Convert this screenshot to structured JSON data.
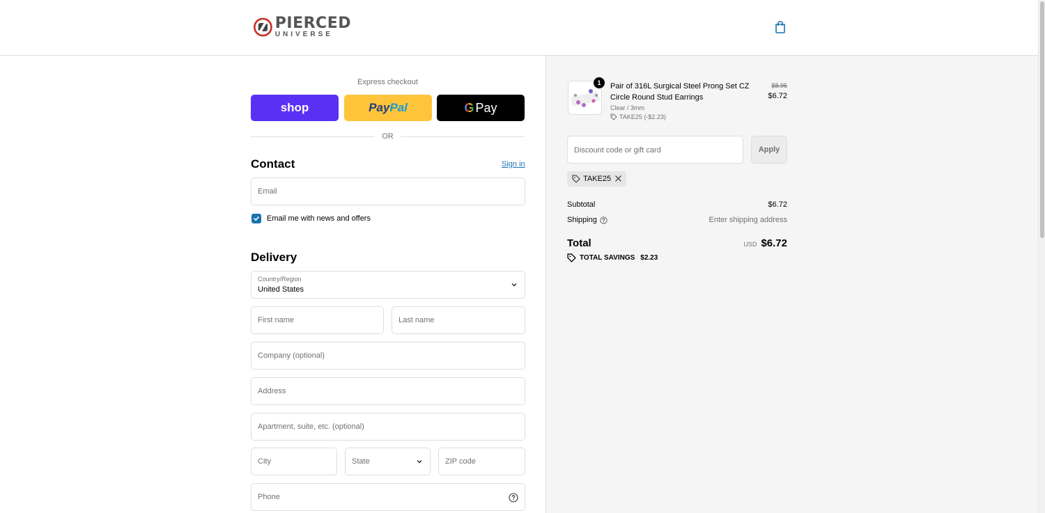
{
  "brand": {
    "logo_line1": "PIERCED",
    "logo_line2": "UNIVERSE"
  },
  "express": {
    "title": "Express checkout",
    "shop_label": "shop",
    "paypal_label_1": "Pay",
    "paypal_label_2": "Pal",
    "gpay_g": "G",
    "gpay_label": "Pay",
    "or_label": "OR"
  },
  "contact": {
    "heading": "Contact",
    "signin": "Sign in",
    "email_placeholder": "Email",
    "newsletter_label": "Email me with news and offers",
    "newsletter_checked": true
  },
  "delivery": {
    "heading": "Delivery",
    "country_label": "Country/Region",
    "country_value": "United States",
    "first_name": "First name",
    "last_name": "Last name",
    "company": "Company (optional)",
    "address": "Address",
    "apartment": "Apartment, suite, etc. (optional)",
    "city": "City",
    "state": "State",
    "zip": "ZIP code",
    "phone": "Phone"
  },
  "order": {
    "item": {
      "quantity": "1",
      "title": "Pair of 316L Surgical Steel Prong Set CZ Circle Round Stud Earrings",
      "variant": "Clear / 3mm",
      "discount": "TAKE25 (-$2.23)",
      "original_price": "$8.95",
      "price": "$6.72"
    },
    "discount_placeholder": "Discount code or gift card",
    "apply_label": "Apply",
    "applied_code": "TAKE25",
    "subtotal_label": "Subtotal",
    "subtotal_value": "$6.72",
    "shipping_label": "Shipping",
    "shipping_value": "Enter shipping address",
    "total_label": "Total",
    "currency": "USD",
    "total_value": "$6.72",
    "savings_label": "TOTAL SAVINGS",
    "savings_value": "$2.23"
  },
  "colors": {
    "accent": "#1773b0",
    "shop": "#5a31f4",
    "paypal": "#ffc439",
    "gpay": "#000000"
  }
}
